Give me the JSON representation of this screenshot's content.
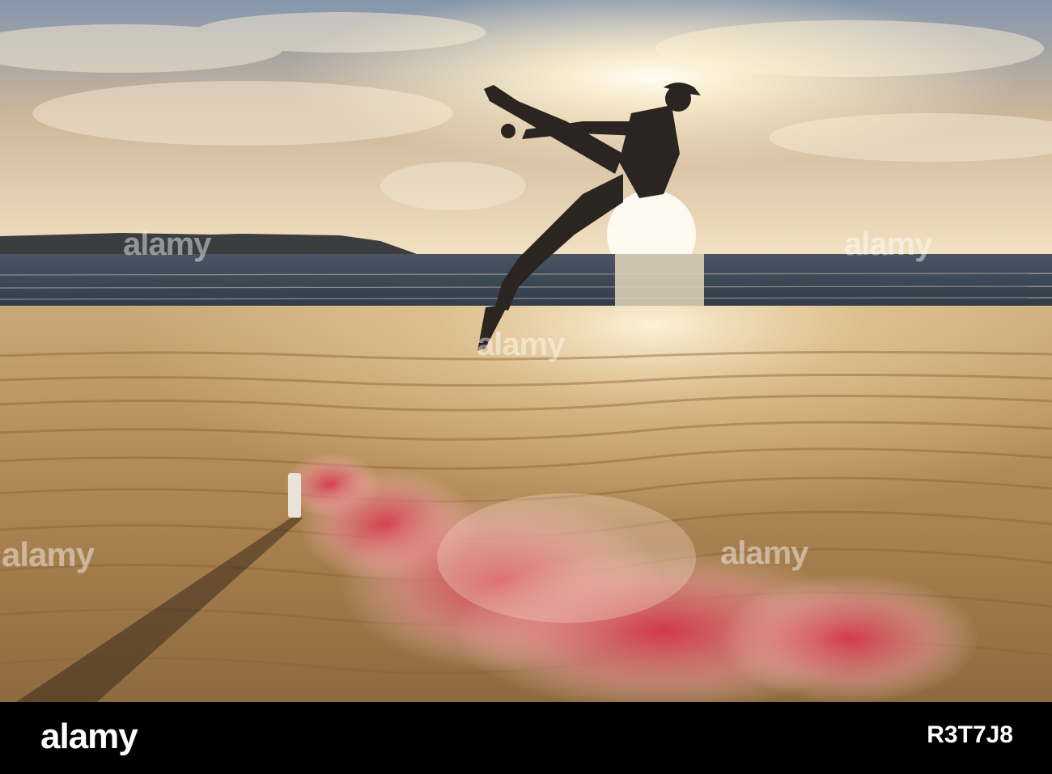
{
  "photo": {
    "subject": "jumper",
    "scene_colors": {
      "sky_top": "#7f8ea3",
      "sky_mid": "#d9c3a1",
      "sun": "#fff8e6",
      "sea": "#3c4a58",
      "sand": "#b58a55",
      "smoke": "#d23a4b"
    }
  },
  "watermarks": {
    "left": "alamy",
    "center": "alamy",
    "center_low": "alamy",
    "top_left": "alamy",
    "top_right": "alamy"
  },
  "footer": {
    "brand": "alamy",
    "stock_id": "R3T7J8"
  }
}
